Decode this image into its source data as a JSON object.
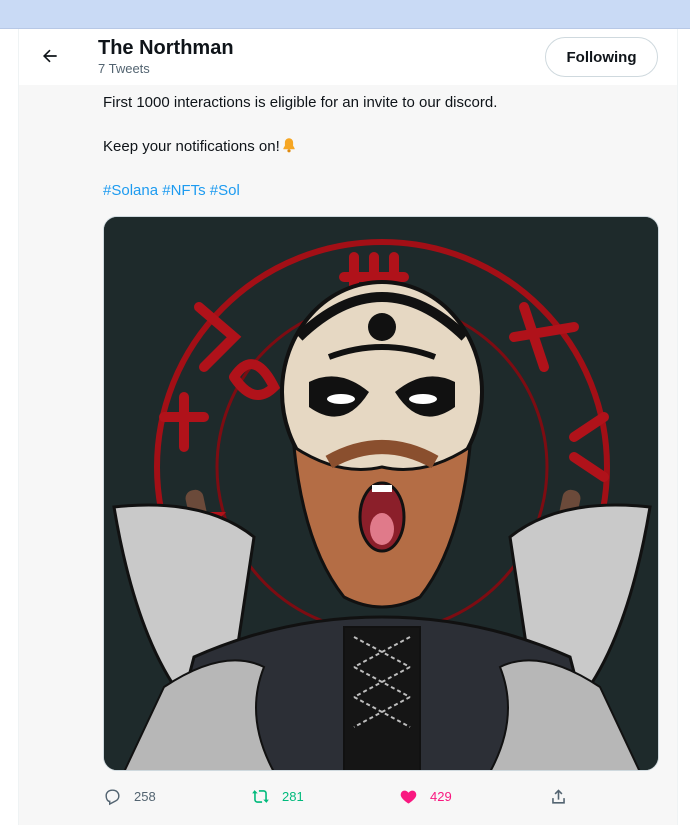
{
  "header": {
    "name": "The Northman",
    "tweet_count": "7 Tweets",
    "follow_label": "Following"
  },
  "tweet": {
    "line1": "First 1000 interactions is eligible for an invite to our discord.",
    "line2": "Keep your notifications on!",
    "hashtags": [
      "#Solana",
      "#NFTs",
      "#Sol"
    ]
  },
  "actions": {
    "replies": "258",
    "retweets": "281",
    "likes": "429"
  },
  "colors": {
    "accent": "#1d9bf0",
    "retweet": "#00ba7c",
    "like": "#f91880",
    "browser_bar": "#c9daf5"
  },
  "icons": [
    "back-arrow-icon",
    "bell-icon",
    "reply-icon",
    "retweet-icon",
    "heart-icon",
    "share-icon"
  ]
}
